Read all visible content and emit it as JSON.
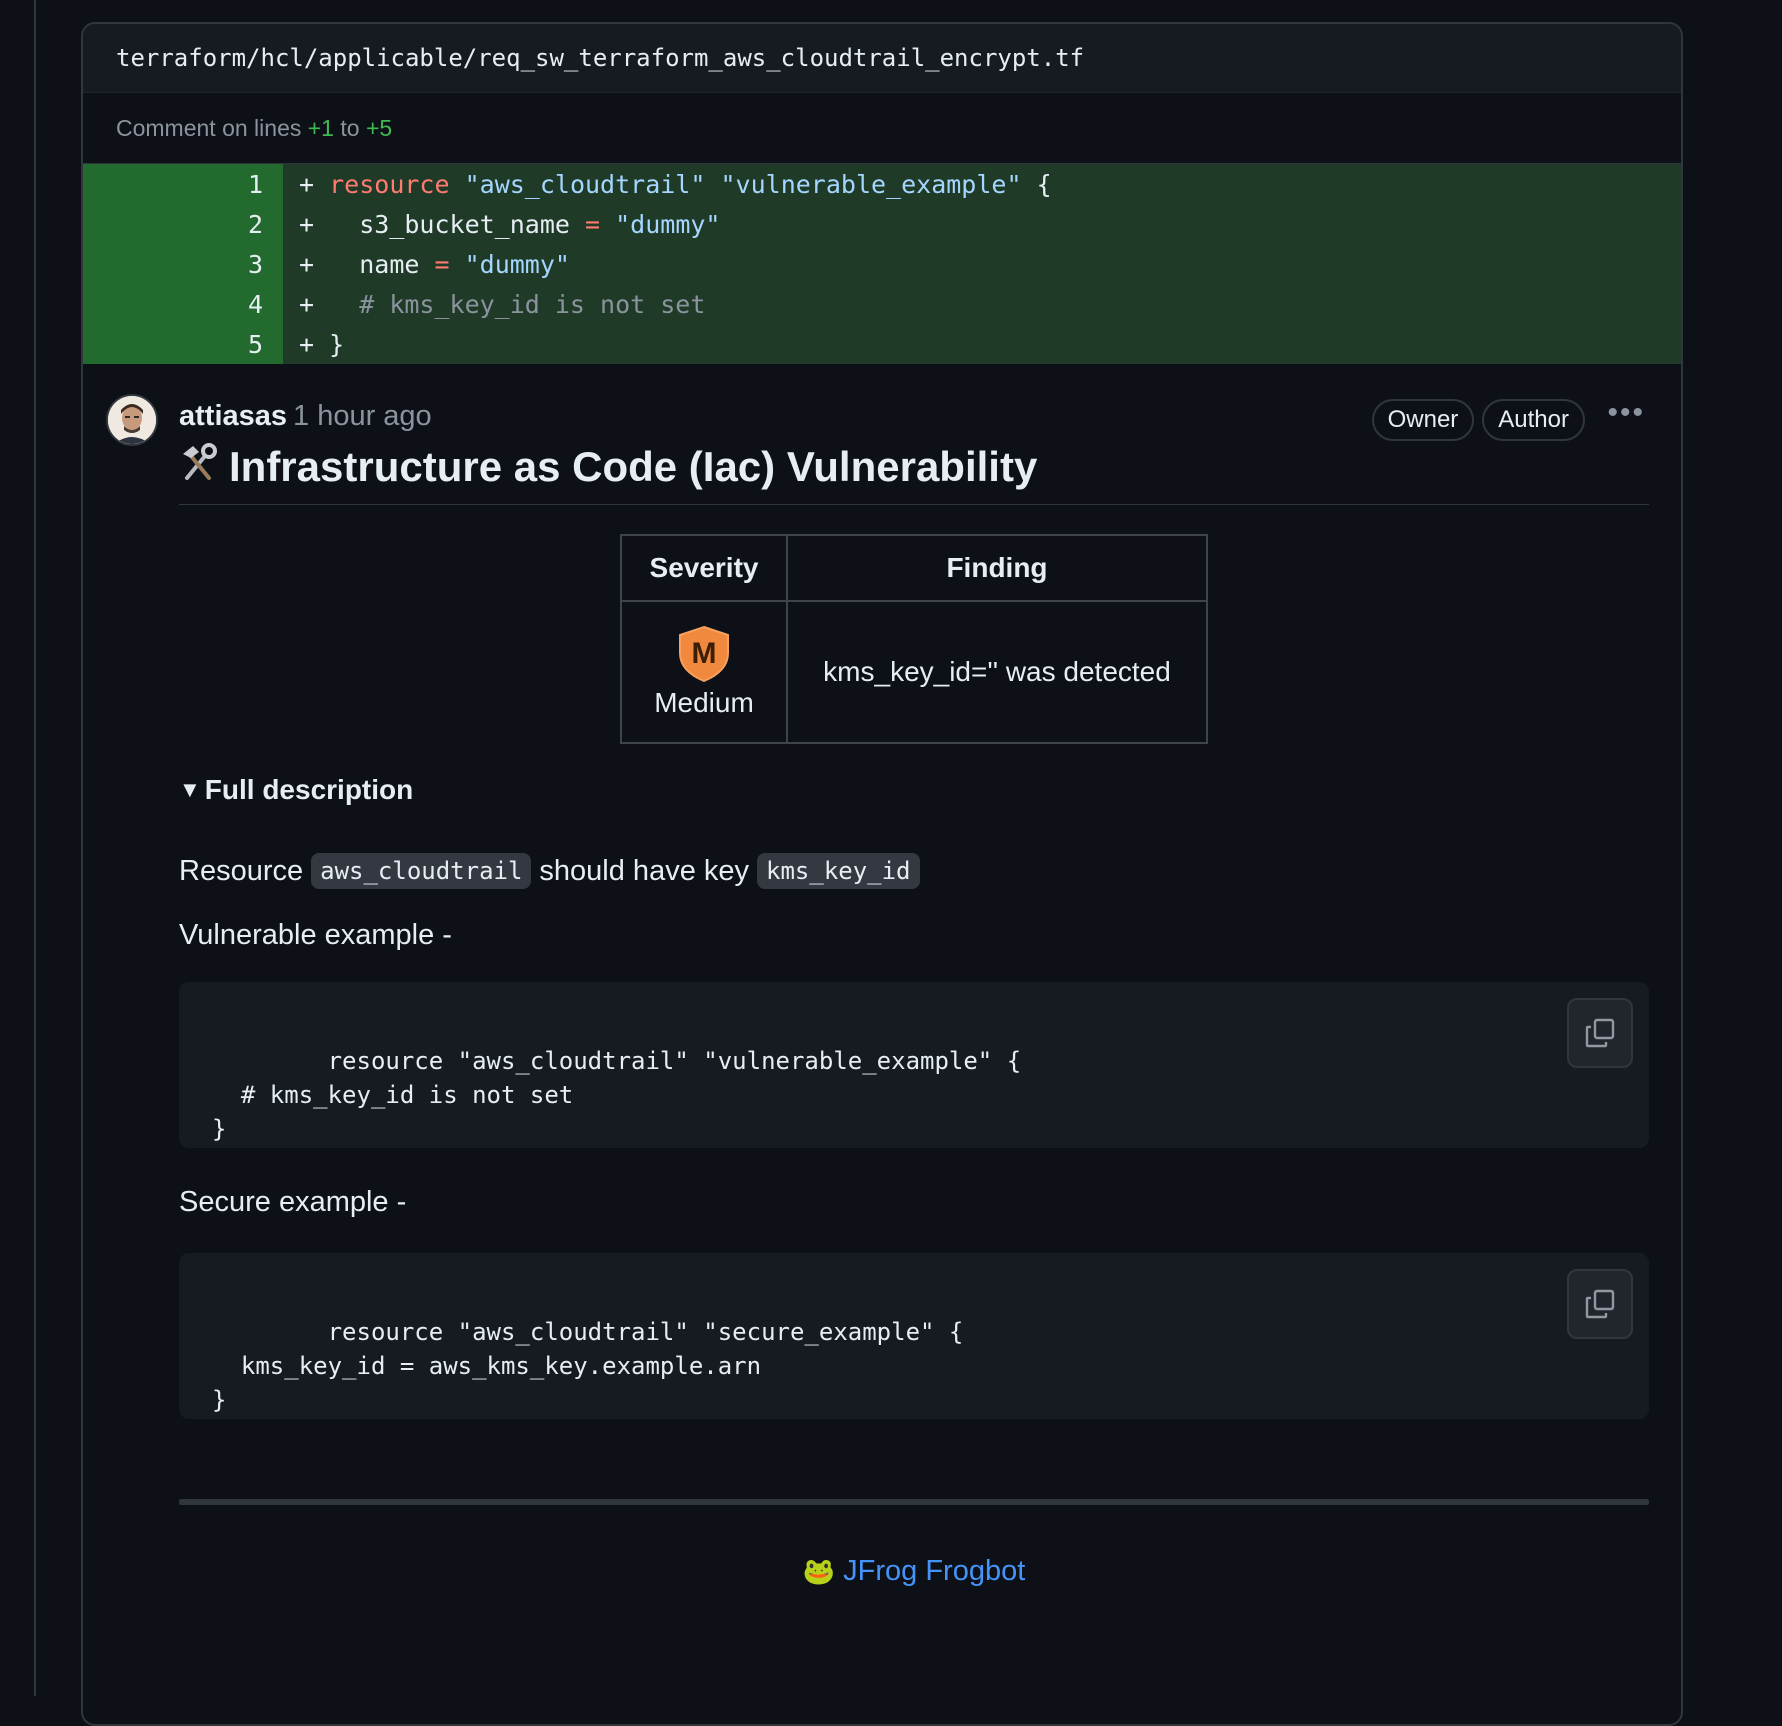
{
  "file": {
    "path": "terraform/hcl/applicable/req_sw_terraform_aws_cloudtrail_encrypt.tf"
  },
  "comment_range": {
    "prefix": "Comment on lines",
    "start": "+1",
    "to": "to",
    "end": "+5"
  },
  "diff": {
    "lines": [
      {
        "num": "1",
        "sign": "+ ",
        "parts": [
          [
            "kw",
            "resource"
          ],
          [
            "plain",
            " "
          ],
          [
            "str",
            "\"aws_cloudtrail\""
          ],
          [
            "plain",
            " "
          ],
          [
            "str",
            "\"vulnerable_example\""
          ],
          [
            "plain",
            " {"
          ]
        ]
      },
      {
        "num": "2",
        "sign": "+ ",
        "parts": [
          [
            "plain",
            "  s3_bucket_name "
          ],
          [
            "op",
            "="
          ],
          [
            "plain",
            " "
          ],
          [
            "str",
            "\"dummy\""
          ]
        ]
      },
      {
        "num": "3",
        "sign": "+ ",
        "parts": [
          [
            "plain",
            "  name "
          ],
          [
            "op",
            "="
          ],
          [
            "plain",
            " "
          ],
          [
            "str",
            "\"dummy\""
          ]
        ]
      },
      {
        "num": "4",
        "sign": "+ ",
        "parts": [
          [
            "cmt",
            "  # kms_key_id is not set"
          ]
        ]
      },
      {
        "num": "5",
        "sign": "+ ",
        "parts": [
          [
            "plain",
            "}"
          ]
        ]
      }
    ]
  },
  "comment": {
    "author": "attiasas",
    "time": "1 hour ago",
    "badges": [
      "Owner",
      "Author"
    ],
    "more_icon": "kebab-horizontal-icon",
    "title_icon": "hammer-wrench-icon",
    "title": "Infrastructure as Code (Iac) Vulnerability",
    "table": {
      "headers": [
        "Severity",
        "Finding"
      ],
      "severity_letter": "M",
      "severity": "Medium",
      "severity_color": "#f0883e",
      "finding": "kms_key_id='' was detected"
    },
    "summary": "Full description",
    "desc": {
      "prefix": "Resource",
      "code1": "aws_cloudtrail",
      "middle": "should have key",
      "code2": "kms_key_id"
    },
    "vuln_label": "Vulnerable example -",
    "vuln_code": "resource \"aws_cloudtrail\" \"vulnerable_example\" {\n  # kms_key_id is not set\n}",
    "secure_label": "Secure example -",
    "secure_code": "resource \"aws_cloudtrail\" \"secure_example\" {\n  kms_key_id = aws_kms_key.example.arn\n}",
    "footer_icon": "🐸",
    "footer_link": "JFrog Frogbot"
  }
}
